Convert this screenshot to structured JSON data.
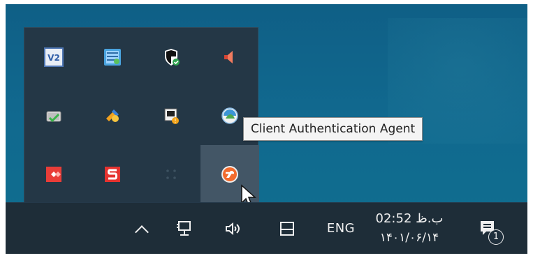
{
  "tray_overflow": {
    "hovered_icon_tooltip": "Client Authentication Agent",
    "icons": [
      {
        "row": 0,
        "col": 0,
        "icon": "v2-app-icon"
      },
      {
        "row": 0,
        "col": 1,
        "icon": "network-map-icon"
      },
      {
        "row": 0,
        "col": 2,
        "icon": "windows-security-shield-icon"
      },
      {
        "row": 0,
        "col": 3,
        "icon": "speaker-icon"
      },
      {
        "row": 1,
        "col": 0,
        "icon": "battery-check-icon"
      },
      {
        "row": 1,
        "col": 1,
        "icon": "tools-icon"
      },
      {
        "row": 1,
        "col": 2,
        "icon": "shield-warning-icon"
      },
      {
        "row": 1,
        "col": 3,
        "icon": "globe-icon"
      },
      {
        "row": 2,
        "col": 0,
        "icon": "anydesk-icon"
      },
      {
        "row": 2,
        "col": 1,
        "icon": "s-app-icon"
      },
      {
        "row": 2,
        "col": 2,
        "icon": "empty-slot-icon"
      },
      {
        "row": 2,
        "col": 3,
        "icon": "client-authentication-agent-icon"
      }
    ]
  },
  "taskbar": {
    "show_hidden_icons": "show-hidden-icons-chevron",
    "network_icon": "network-icon",
    "volume_icon": "volume-icon",
    "touch_keyboard_icon": "touch-keyboard-icon",
    "language": "ENG",
    "clock": {
      "time": "02:52 ب.ظ",
      "date": "۱۴۰۱/۰۶/۱۴"
    },
    "notifications": {
      "icon": "action-center-icon",
      "count": "1"
    }
  },
  "colors": {
    "desktop": "#0f6a8f",
    "flyout": "#243746",
    "taskbar": "#1e2d38",
    "tooltip_bg": "#f4f4f4"
  }
}
